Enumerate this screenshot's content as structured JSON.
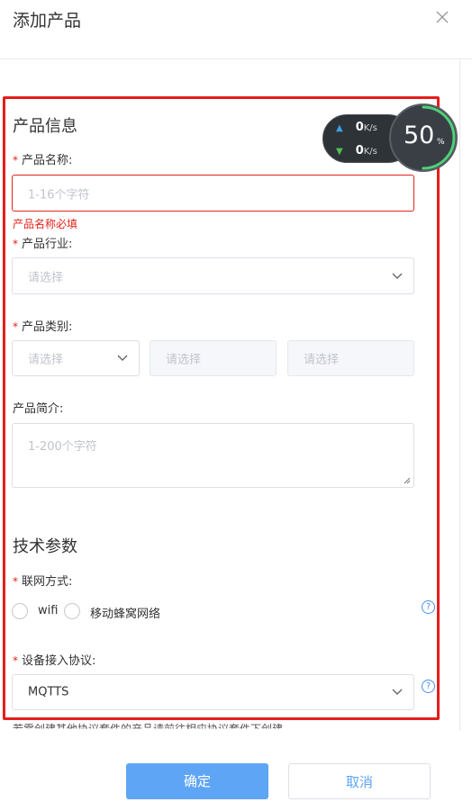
{
  "dialog": {
    "title": "添加产品"
  },
  "product_info": {
    "section_title": "产品信息",
    "name": {
      "label": "产品名称:",
      "placeholder": "1-16个字符",
      "error": "产品名称必填"
    },
    "industry": {
      "label": "产品行业:",
      "placeholder": "请选择"
    },
    "category": {
      "label": "产品类别:",
      "select1_placeholder": "请选择",
      "select2_placeholder": "请选择",
      "select3_placeholder": "请选择"
    },
    "description": {
      "label": "产品简介:",
      "placeholder": "1-200个字符"
    }
  },
  "tech_params": {
    "section_title": "技术参数",
    "network": {
      "label": "联网方式:",
      "options": [
        "wifi",
        "移动蜂窝网络"
      ],
      "help": "?"
    },
    "protocol": {
      "label": "设备接入协议:",
      "value": "MQTTS",
      "help": "?"
    },
    "note": "若需创建其他协议套件的产品请前往相应协议套件下创建"
  },
  "speed_widget": {
    "up_value": "0",
    "down_value": "0",
    "unit": "K/s",
    "percent": "50",
    "percent_sign": "%",
    "percent_fraction": 0.5
  },
  "footer": {
    "confirm_label": "确定",
    "cancel_label": "取消"
  },
  "colors": {
    "required": "#e2231a",
    "primary": "#5ea5f5",
    "highlight_outline": "#e61d1d"
  }
}
